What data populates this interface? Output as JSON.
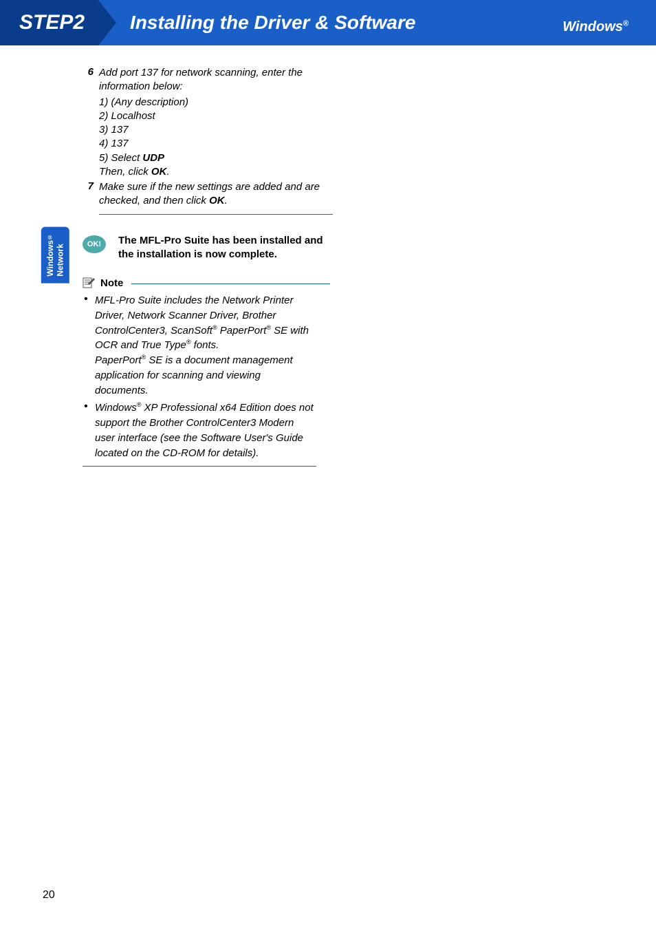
{
  "header": {
    "step": "STEP2",
    "title": "Installing the Driver & Software",
    "platform": "Windows",
    "reg": "®"
  },
  "sidetab": {
    "line1": "Windows",
    "reg": "®",
    "line2": "Network"
  },
  "steps": {
    "s6": {
      "num": "6",
      "intro": "Add port 137 for network scanning, enter the information below:",
      "i1": "1)  (Any description)",
      "i2": "2)  Localhost",
      "i3": "3)  137",
      "i4": "4)  137",
      "i5a": "5)  Select ",
      "i5b": "UDP",
      "then_a": "Then, click ",
      "then_b": "OK",
      "then_c": "."
    },
    "s7": {
      "num": "7",
      "text_a": "Make sure if the new settings are added and are checked, and then click ",
      "text_b": "OK",
      "text_c": "."
    }
  },
  "ok": {
    "badge": "OK!",
    "text": "The MFL-Pro Suite has been installed and the installation is now complete."
  },
  "note": {
    "label": "Note",
    "b1_a": "MFL-Pro Suite includes the Network Printer Driver, Network Scanner Driver, Brother ControlCenter3, ScanSoft",
    "b1_b": " PaperPort",
    "b1_c": " SE with OCR and True Type",
    "b1_d": " fonts.",
    "b1_e": "PaperPort",
    "b1_f": " SE is a document management application for scanning and viewing documents.",
    "b2_a": "Windows",
    "b2_b": " XP Professional x64 Edition does not support the Brother ControlCenter3 Modern user interface (see the Software User's Guide located on the CD-ROM for details)."
  },
  "reg": "®",
  "page": "20"
}
